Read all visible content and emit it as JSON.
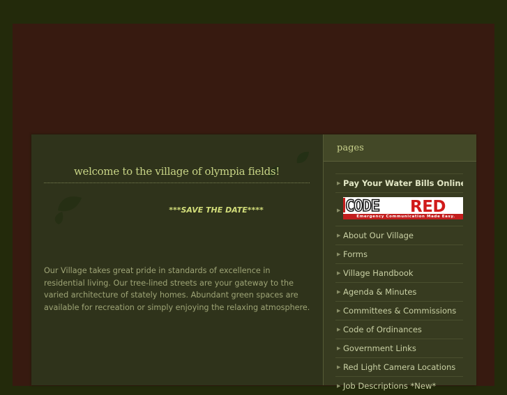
{
  "main": {
    "welcome_title": "welcome to the village of olympia fields!",
    "save_the_date": "***SAVE THE DATE****",
    "intro": "Our Village takes great pride in standards of excellence in residential living. Our tree-lined streets are your gateway to the varied architecture of stately homes.  Abundant green spaces are available for recreation or simply enjoying the relaxing atmosphere."
  },
  "sidebar": {
    "heading": "pages",
    "items": [
      {
        "label": "Pay Your Water Bills Online",
        "bold": true
      },
      {
        "label": "",
        "logo": "code-red"
      },
      {
        "label": "About Our Village"
      },
      {
        "label": "Forms"
      },
      {
        "label": "Village Handbook"
      },
      {
        "label": "Agenda & Minutes"
      },
      {
        "label": "Committees & Commissions"
      },
      {
        "label": "Code of Ordinances"
      },
      {
        "label": "Government Links"
      },
      {
        "label": "Red Light Camera Locations"
      },
      {
        "label": "Job Descriptions *New*"
      }
    ],
    "code_red": {
      "code": "CODE",
      "red": "RED",
      "tagline": "Emergency Communication Made Easy."
    }
  },
  "colors": {
    "outer_bg": "#232a0b",
    "frame_bg": "#371a10",
    "content_bg": "#2f331b",
    "sidebar_bg": "#373b20",
    "accent_text": "#c8d486"
  },
  "icons": [
    "leaf-icon",
    "nav-arrow-icon"
  ]
}
